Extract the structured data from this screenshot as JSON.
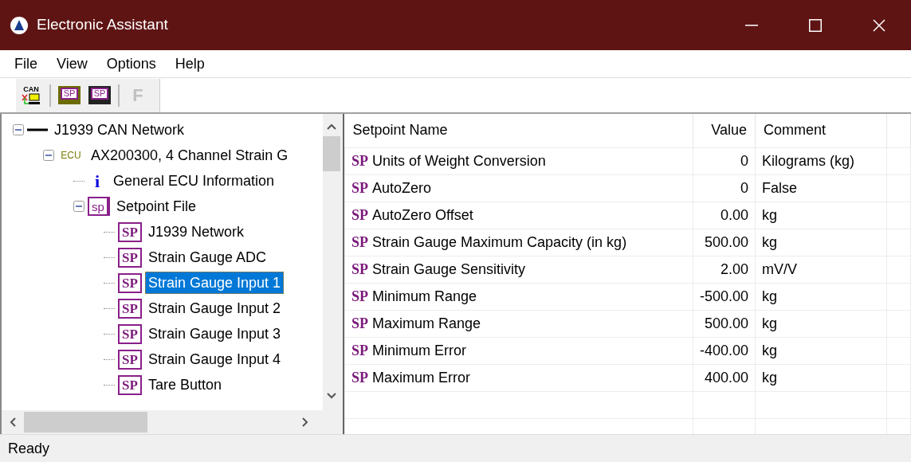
{
  "window": {
    "title": "Electronic Assistant"
  },
  "menu": [
    "File",
    "View",
    "Options",
    "Help"
  ],
  "toolbar": [
    {
      "kind": "can",
      "icon_text": "CAN",
      "disabled": false
    },
    {
      "kind": "separator"
    },
    {
      "kind": "open",
      "icon_text": "SP",
      "disabled": false
    },
    {
      "kind": "save",
      "icon_text": "SP",
      "disabled": false
    },
    {
      "kind": "separator"
    },
    {
      "kind": "flash",
      "icon_text": "F",
      "disabled": true
    }
  ],
  "tree": [
    {
      "label": "J1939 CAN Network",
      "kind": "network",
      "expanded": true,
      "selected": false,
      "children": [
        {
          "label": "AX200300, 4 Channel Strain G",
          "kind": "ecu",
          "icon_text": "ECU",
          "expanded": true,
          "selected": false,
          "children": [
            {
              "label": "General ECU Information",
              "kind": "info",
              "icon_text": "i",
              "selected": false
            },
            {
              "label": "Setpoint File",
              "kind": "file",
              "icon_text": "sp",
              "expanded": true,
              "selected": false,
              "children": [
                {
                  "label": "J1939 Network",
                  "kind": "setpoint",
                  "icon_text": "SP",
                  "selected": false
                },
                {
                  "label": "Strain Gauge ADC",
                  "kind": "setpoint",
                  "icon_text": "SP",
                  "selected": false
                },
                {
                  "label": "Strain Gauge Input 1",
                  "kind": "setpoint",
                  "icon_text": "SP",
                  "selected": true
                },
                {
                  "label": "Strain Gauge Input 2",
                  "kind": "setpoint",
                  "icon_text": "SP",
                  "selected": false
                },
                {
                  "label": "Strain Gauge Input 3",
                  "kind": "setpoint",
                  "icon_text": "SP",
                  "selected": false
                },
                {
                  "label": "Strain Gauge Input 4",
                  "kind": "setpoint",
                  "icon_text": "SP",
                  "selected": false
                },
                {
                  "label": "Tare Button",
                  "kind": "setpoint",
                  "icon_text": "SP",
                  "selected": false
                }
              ]
            }
          ]
        }
      ]
    }
  ],
  "table": {
    "columns": [
      "Setpoint Name",
      "Value",
      "Comment"
    ],
    "rows": [
      {
        "icon_text": "SP",
        "name": "Units of Weight Conversion",
        "value": "0",
        "comment": "Kilograms (kg)"
      },
      {
        "icon_text": "SP",
        "name": "AutoZero",
        "value": "0",
        "comment": "False"
      },
      {
        "icon_text": "SP",
        "name": "AutoZero Offset",
        "value": "0.00",
        "comment": "kg"
      },
      {
        "icon_text": "SP",
        "name": "Strain Gauge Maximum Capacity (in kg)",
        "value": "500.00",
        "comment": "kg"
      },
      {
        "icon_text": "SP",
        "name": "Strain Gauge Sensitivity",
        "value": "2.00",
        "comment": "mV/V"
      },
      {
        "icon_text": "SP",
        "name": "Minimum Range",
        "value": "-500.00",
        "comment": "kg"
      },
      {
        "icon_text": "SP",
        "name": "Maximum Range",
        "value": "500.00",
        "comment": "kg"
      },
      {
        "icon_text": "SP",
        "name": "Minimum Error",
        "value": "-400.00",
        "comment": "kg"
      },
      {
        "icon_text": "SP",
        "name": "Maximum Error",
        "value": "400.00",
        "comment": "kg"
      }
    ]
  },
  "status_bar": "Ready"
}
